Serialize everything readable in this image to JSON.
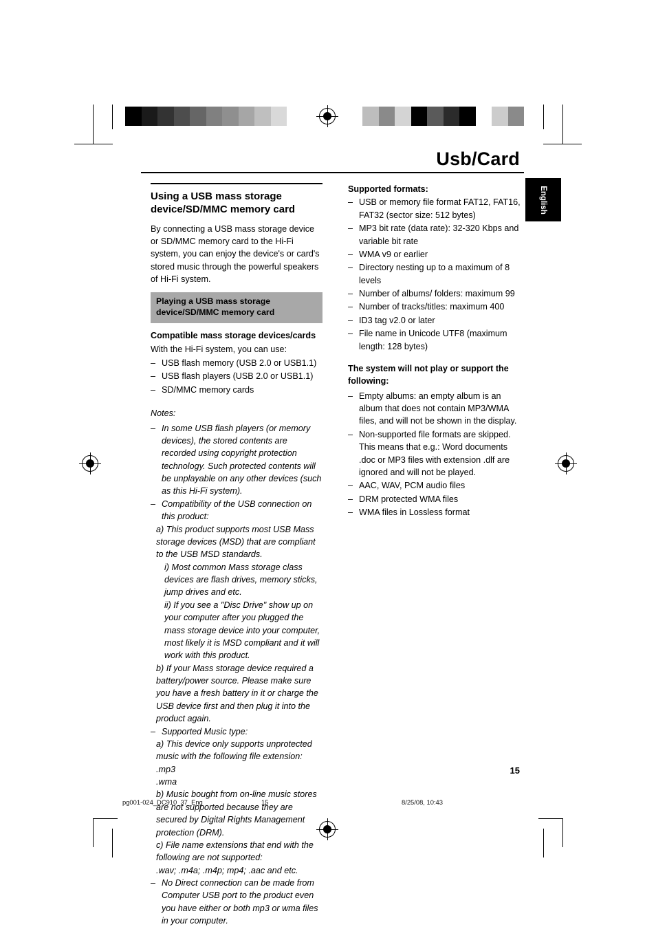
{
  "header": {
    "title": "Usb/Card",
    "language_tab": "English"
  },
  "left_column": {
    "section_title": "Using a USB mass storage device/SD/MMC memory card",
    "intro": "By connecting a USB mass storage device or SD/MMC memory card to the Hi-Fi system, you can enjoy the device's or card's stored music through the powerful speakers of Hi-Fi system.",
    "banner": "Playing a USB mass storage device/SD/MMC memory card",
    "compatible_heading": "Compatible mass storage devices/cards",
    "compatible_intro": "With the Hi-Fi system, you can use:",
    "compatible_items": [
      "USB flash memory (USB 2.0 or USB1.1)",
      "USB flash players (USB 2.0 or USB1.1)",
      "SD/MMC memory cards"
    ],
    "notes_label": "Notes:",
    "notes": [
      "In some USB flash players (or memory devices), the stored contents are recorded using copyright protection technology. Such protected contents will be unplayable on any other devices (such as this Hi-Fi system).",
      "Compatibility of the USB connection on this product:"
    ],
    "note_b_items": [
      "a) This product supports most USB Mass storage devices (MSD) that are compliant to the USB MSD standards.",
      "i) Most common Mass storage class devices are flash drives, memory sticks, jump drives and etc.",
      "ii) If you see a \"Disc Drive\" show up on your computer after you plugged the mass storage device into your computer, most likely it is MSD compliant and it will work with this product.",
      "b) If your Mass storage device required a battery/power source. Please make sure you have a fresh battery in it or charge the USB device first and then plug it into the product again."
    ],
    "music_type_note": "Supported Music type:",
    "music_type_items": [
      "a) This device only supports unprotected music with the following file extension:",
      ".mp3",
      ".wma",
      "b) Music bought from on-line music stores are not supported because they are secured by Digital Rights Management protection (DRM).",
      "c) File name extensions that end with the following are not supported:",
      ".wav; .m4a; .m4p; mp4; .aac and etc."
    ],
    "last_note": "No Direct connection can be made from Computer USB port to the product even you have either or both mp3 or wma files in your computer."
  },
  "right_column": {
    "supported_heading": "Supported formats:",
    "supported_items": [
      "USB or memory file format FAT12, FAT16, FAT32 (sector size: 512 bytes)",
      "MP3 bit rate (data rate): 32-320 Kbps and variable bit rate",
      "WMA v9 or earlier",
      "Directory nesting up to a maximum of 8 levels",
      "Number of albums/ folders: maximum 99",
      "Number of tracks/titles: maximum 400",
      "ID3 tag v2.0 or later",
      "File name in Unicode UTF8 (maximum length: 128 bytes)"
    ],
    "not_supported_heading": "The system will not play or support the following:",
    "not_supported_items": [
      "Empty albums: an empty album is an album that does not contain MP3/WMA files, and will not be shown in the display.",
      "Non-supported file formats are skipped. This means that e.g.: Word documents .doc or MP3 files with extension .dlf are ignored and will not be played.",
      "AAC, WAV, PCM audio files",
      "DRM protected WMA files",
      "WMA files in Lossless format"
    ]
  },
  "page_number": "15",
  "footer": {
    "file": "pg001-024_DC910_37_Eng",
    "page": "15",
    "date": "8/25/08, 10:43"
  },
  "colors": {
    "banner_bg": "#a8a8a8",
    "tab_bg": "#000000"
  },
  "color_bar_left": [
    "#000000",
    "#1a1a1a",
    "#333333",
    "#4d4d4d",
    "#666666",
    "#808080",
    "#8f8f8f",
    "#a6a6a6",
    "#bfbfbf",
    "#d9d9d9",
    "#ffffff"
  ],
  "color_bar_right": [
    "#bdbdbd",
    "#8a8a8a",
    "#d4d4d4",
    "#000000",
    "#5a5a5a",
    "#2b2b2b",
    "#000000",
    "#ffffff",
    "#cccccc",
    "#8a8a8a"
  ]
}
